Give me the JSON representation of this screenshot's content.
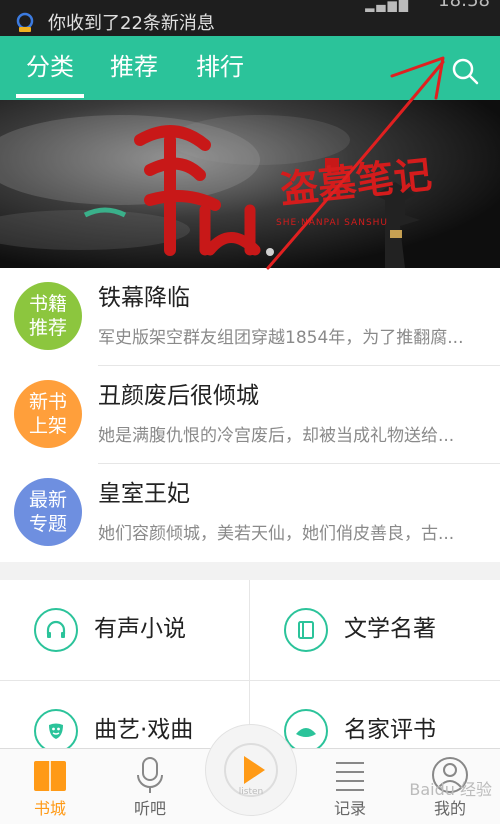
{
  "status_bar": {
    "notification": "你收到了22条新消息",
    "time": "18:58"
  },
  "nav": {
    "tabs": [
      {
        "label": "分类",
        "active": true
      },
      {
        "label": "推荐",
        "active": false
      },
      {
        "label": "排行",
        "active": false
      }
    ],
    "search_icon": "search-icon"
  },
  "banner": {
    "title_big": "盗墓笔记",
    "sub": "SHE·NANPAI SANSHU"
  },
  "list": [
    {
      "badge": [
        "书籍",
        "推荐"
      ],
      "badge_color": "#8cc63e",
      "title": "铁幕降临",
      "desc": "军史版架空群友组团穿越1854年，为了推翻腐..."
    },
    {
      "badge": [
        "新书",
        "上架"
      ],
      "badge_color": "#ff9f3b",
      "title": "丑颜废后很倾城",
      "desc": "她是满腹仇恨的冷宫废后，却被当成礼物送给..."
    },
    {
      "badge": [
        "最新",
        "专题"
      ],
      "badge_color": "#6e8fe0",
      "title": "皇室王妃",
      "desc": "她们容颜倾城，美若天仙，她们俏皮善良，古..."
    }
  ],
  "grid": [
    {
      "label": "有声小说",
      "icon": "headphones-icon"
    },
    {
      "label": "文学名著",
      "icon": "book-icon"
    },
    {
      "label": "曲艺·戏曲",
      "icon": "opera-mask-icon"
    },
    {
      "label": "名家评书",
      "icon": "fan-icon"
    }
  ],
  "bottom": {
    "tabs": [
      {
        "label": "书城",
        "icon": "bookstore-icon",
        "active": true
      },
      {
        "label": "听吧",
        "icon": "microphone-icon",
        "active": false
      },
      {
        "label": "记录",
        "icon": "history-icon",
        "active": false
      },
      {
        "label": "我的",
        "icon": "profile-icon",
        "active": false
      }
    ],
    "player_label": "listen",
    "watermark": "Baidu 经验"
  },
  "colors": {
    "accent": "#2bc39a",
    "active_tab": "#ff9a16",
    "annotation": "#e02020"
  }
}
